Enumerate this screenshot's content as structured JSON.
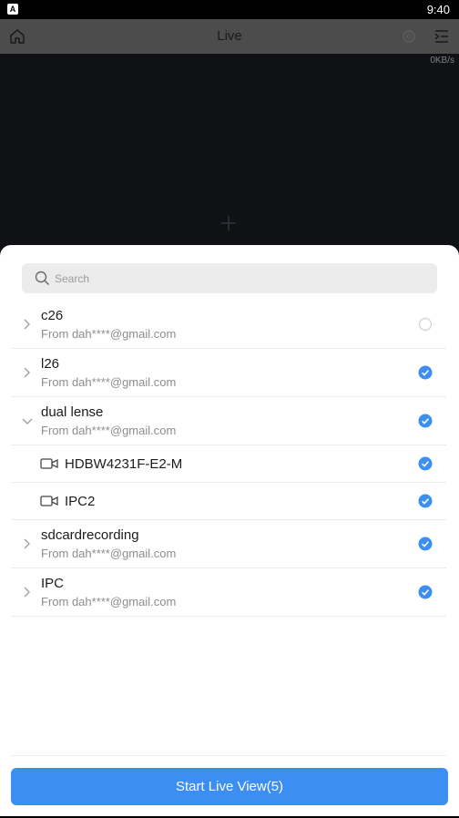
{
  "status_bar": {
    "time": "9:40",
    "app_badge": "A"
  },
  "header": {
    "title": "Live"
  },
  "video": {
    "rate": "0KB/s"
  },
  "search": {
    "placeholder": "Search"
  },
  "devices": [
    {
      "name": "c26",
      "from": "From dah****@gmail.com",
      "checked": false,
      "expanded": false
    },
    {
      "name": "l26",
      "from": "From dah****@gmail.com",
      "checked": true,
      "expanded": false
    },
    {
      "name": "dual lense",
      "from": "From dah****@gmail.com",
      "checked": true,
      "expanded": true,
      "channels": [
        {
          "name": "HDBW4231F-E2-M",
          "checked": true
        },
        {
          "name": "IPC2",
          "checked": true
        }
      ]
    },
    {
      "name": "sdcardrecording",
      "from": "From dah****@gmail.com",
      "checked": true,
      "expanded": false
    },
    {
      "name": "IPC",
      "from": "From dah****@gmail.com",
      "checked": true,
      "expanded": false
    }
  ],
  "footer": {
    "start_label": "Start Live View(5)"
  },
  "colors": {
    "accent": "#3d8ef3",
    "header_bg": "#4c4c4c",
    "video_bg": "#0f1115"
  },
  "icons": {
    "home": "home-icon",
    "gear": "gear-icon",
    "menu": "menu-icon",
    "search": "search-icon",
    "plus": "plus-icon",
    "camera": "camera-icon",
    "check": "check-circle-icon"
  }
}
